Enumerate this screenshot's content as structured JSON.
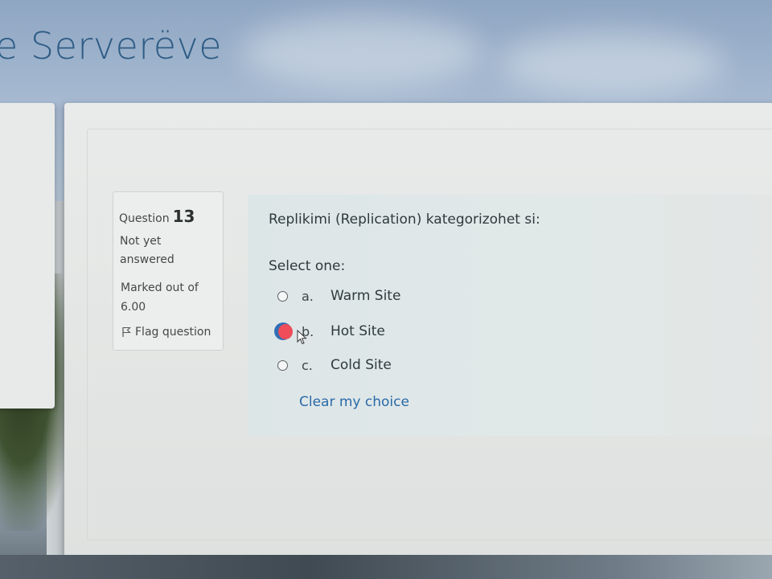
{
  "header": {
    "site_title": "e Serverëve"
  },
  "question": {
    "label": "Question",
    "number": "13",
    "state": "Not yet answered",
    "grade": "Marked out of 6.00",
    "flag_label": "Flag question",
    "text": "Replikimi (Replication) kategorizohet si:",
    "prompt": "Select one:",
    "options": [
      {
        "letter": "a.",
        "label": "Warm Site",
        "selected": false
      },
      {
        "letter": "b.",
        "label": "Hot Site",
        "selected": true
      },
      {
        "letter": "c.",
        "label": "Cold Site",
        "selected": false
      }
    ],
    "clear_label": "Clear my choice"
  },
  "colors": {
    "title": "#2f5d86",
    "link": "#2b6aa8",
    "radio_selected": "#2f6fb6",
    "highlight_marker": "#ef4d5a"
  }
}
